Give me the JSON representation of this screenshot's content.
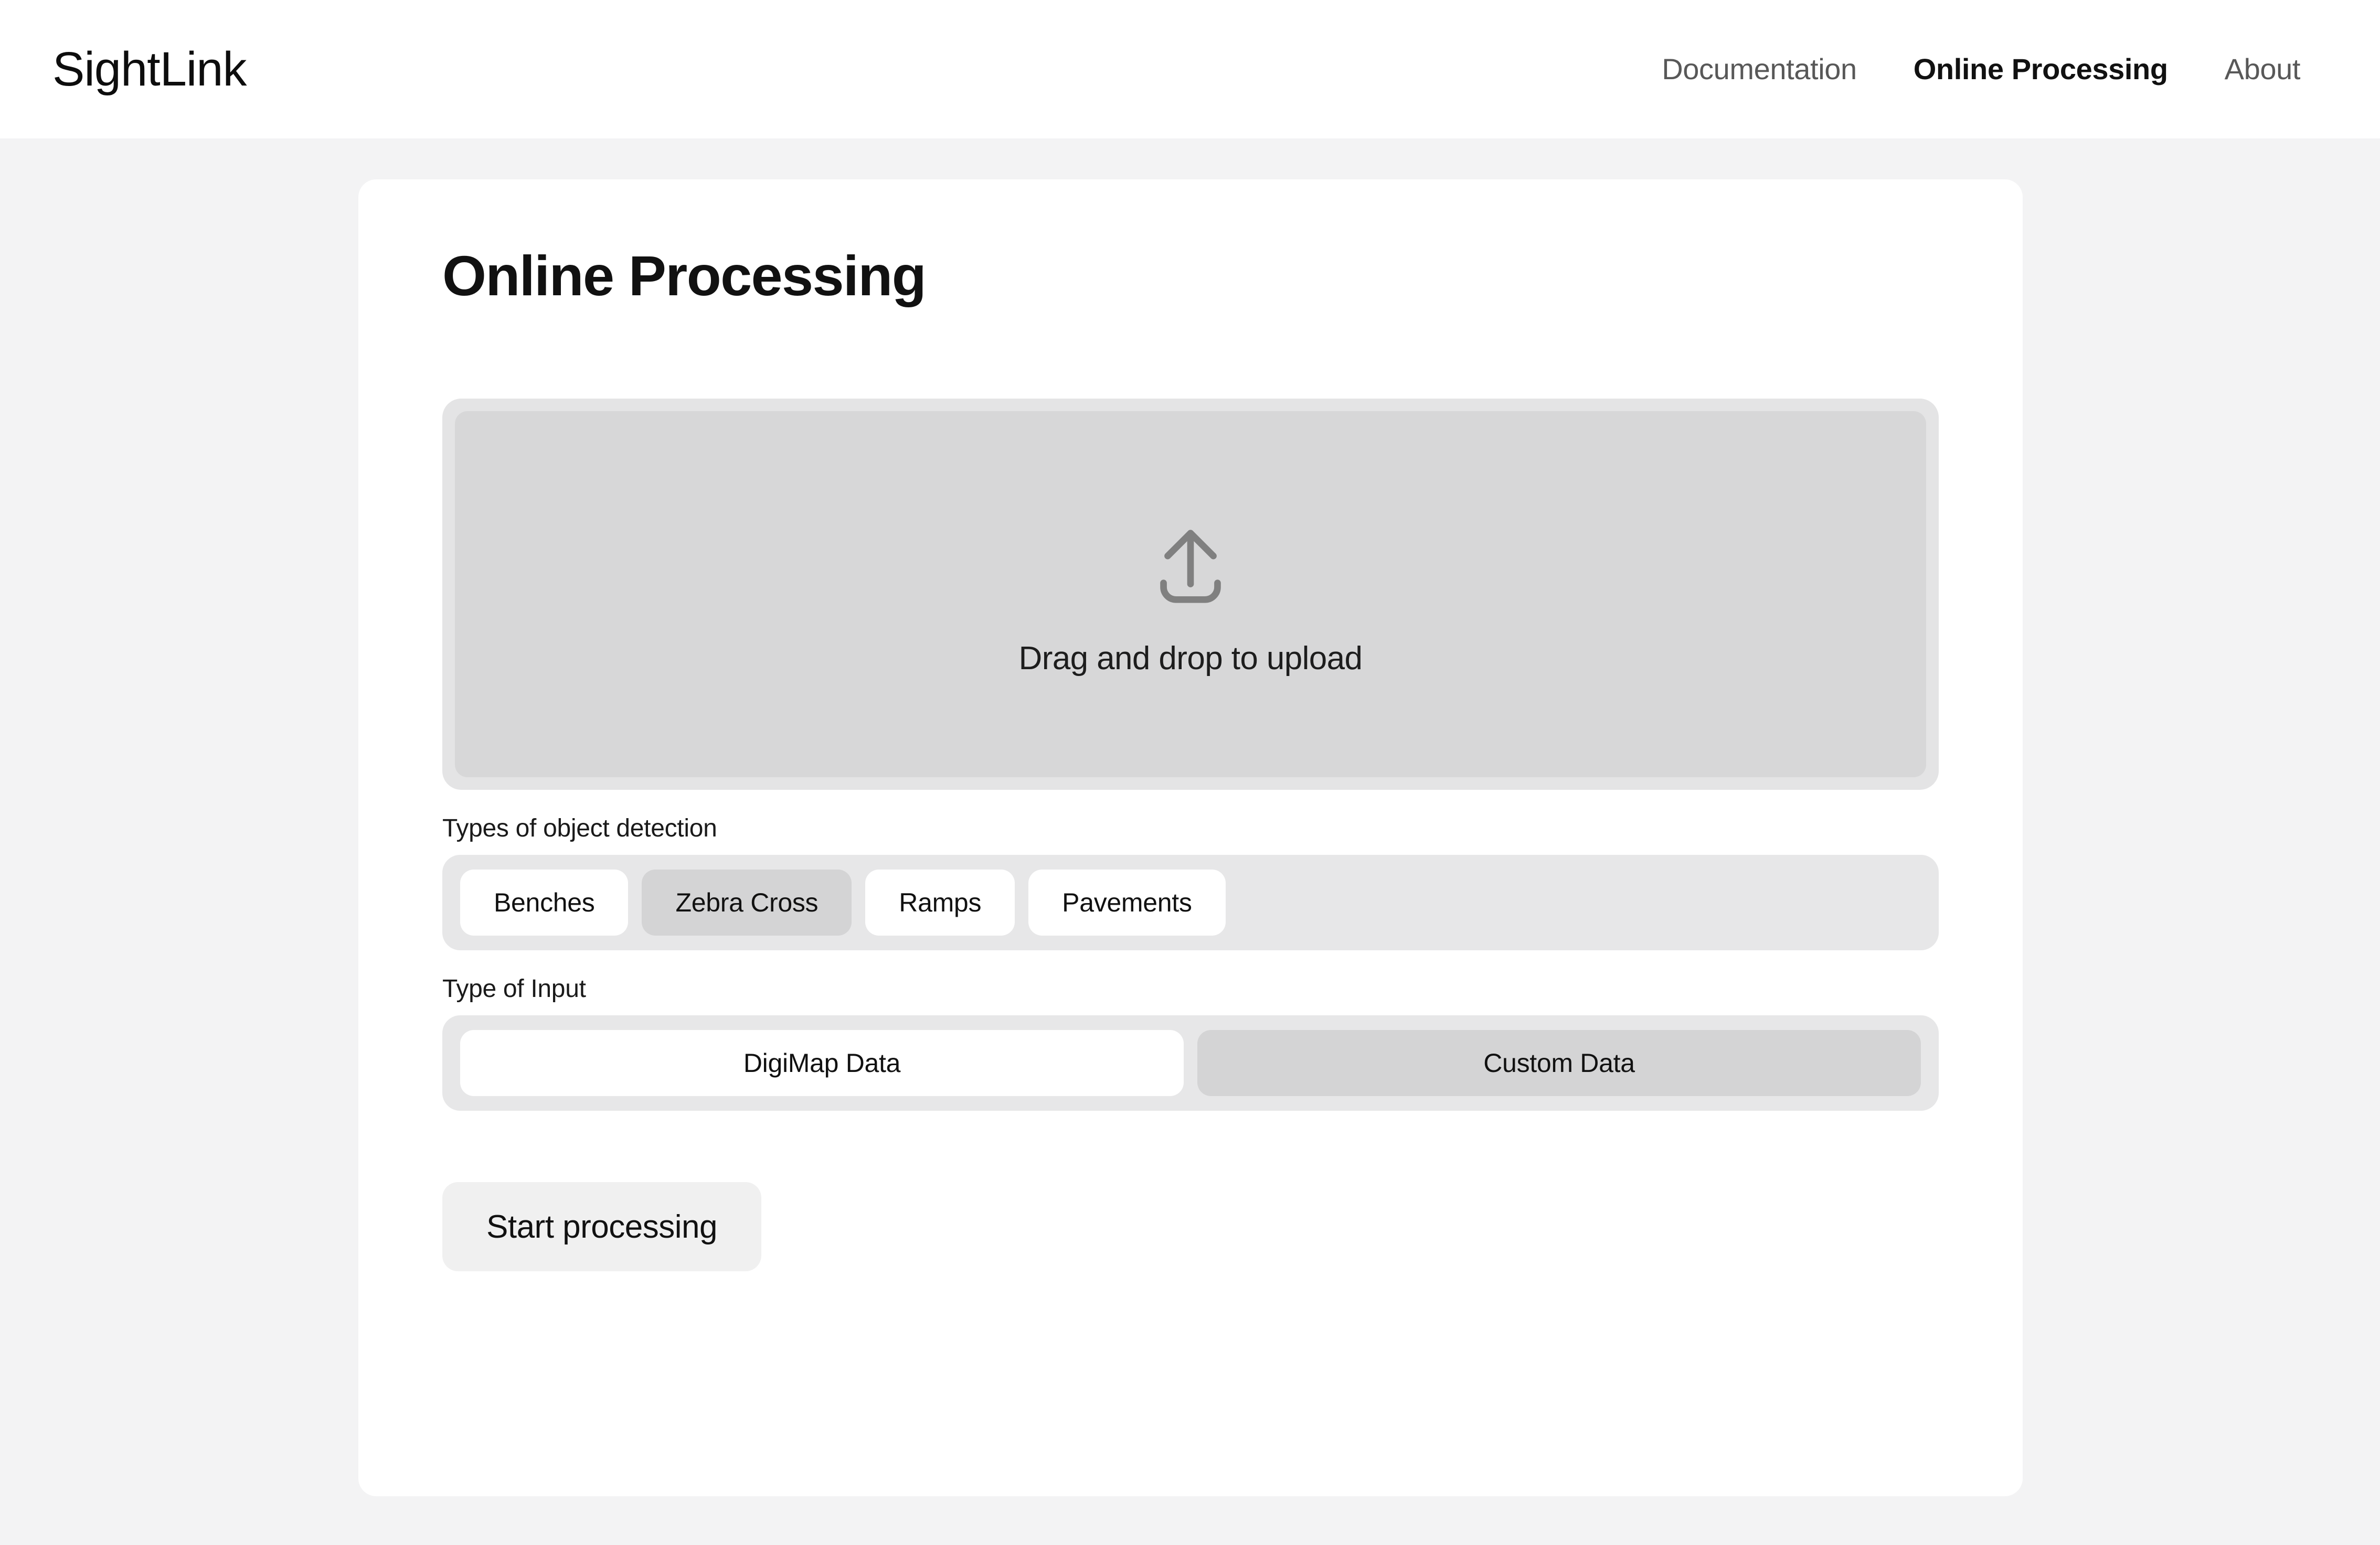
{
  "header": {
    "brand": "SightLink",
    "nav": [
      {
        "label": "Documentation",
        "active": false
      },
      {
        "label": "Online Processing",
        "active": true
      },
      {
        "label": "About",
        "active": false
      }
    ]
  },
  "main": {
    "title": "Online Processing",
    "dropzone": {
      "icon": "upload-arrow-icon",
      "label": "Drag and drop to upload"
    },
    "detection": {
      "label": "Types of object detection",
      "options": [
        {
          "label": "Benches",
          "selected": false
        },
        {
          "label": "Zebra Cross",
          "selected": true
        },
        {
          "label": "Ramps",
          "selected": false
        },
        {
          "label": "Pavements",
          "selected": false
        }
      ]
    },
    "input_type": {
      "label": "Type of Input",
      "options": [
        {
          "label": "DigiMap Data",
          "selected": false
        },
        {
          "label": "Custom Data",
          "selected": true
        }
      ]
    },
    "start_button": "Start processing"
  },
  "colors": {
    "page_background": "#f3f3f4",
    "header_background": "#ffffff",
    "card_background": "#ffffff",
    "dropzone_outer": "#e4e4e5",
    "dropzone_inner": "#d7d7d8",
    "segment_track": "#e7e7e8",
    "segment_unselected": "#ffffff",
    "segment_selected": "#d4d4d5",
    "button_background": "#f0f0f0",
    "text_primary": "#111111",
    "text_muted": "#585858",
    "icon_stroke": "#808080"
  }
}
